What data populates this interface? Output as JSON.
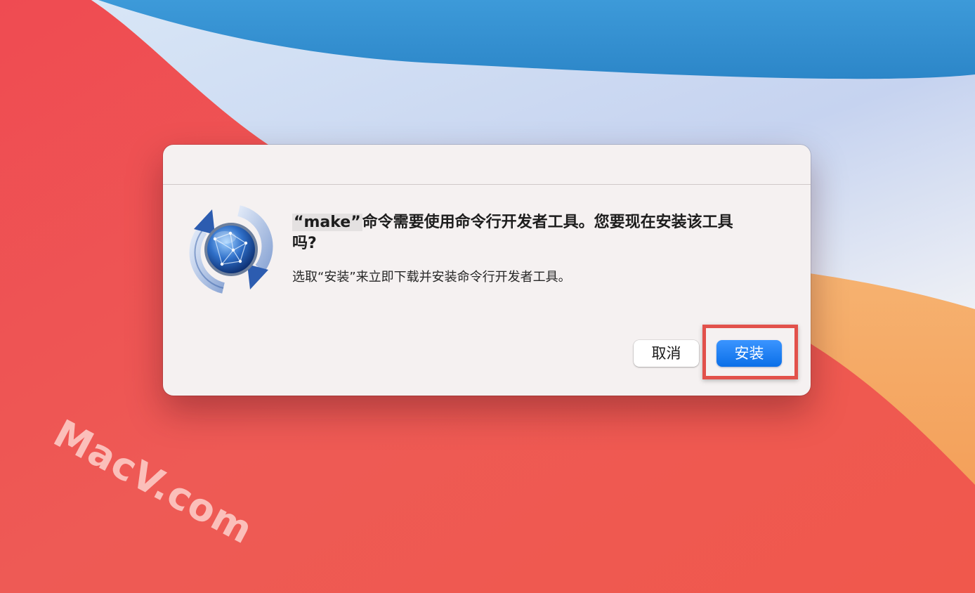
{
  "watermark": "MacV.com",
  "dialog": {
    "title_command": "“make”",
    "title_rest": "命令需要使用命令行开发者工具。您要现在安装该工具吗?",
    "body": "选取“安装”来立即下载并安装命令行开发者工具。",
    "cancel_label": "取消",
    "install_label": "安装",
    "icon": "software-update-globe-icon"
  },
  "colors": {
    "accent": "#0a6fe8",
    "highlight_box": "#e2514b",
    "dialog_bg": "#f5f1f1"
  }
}
